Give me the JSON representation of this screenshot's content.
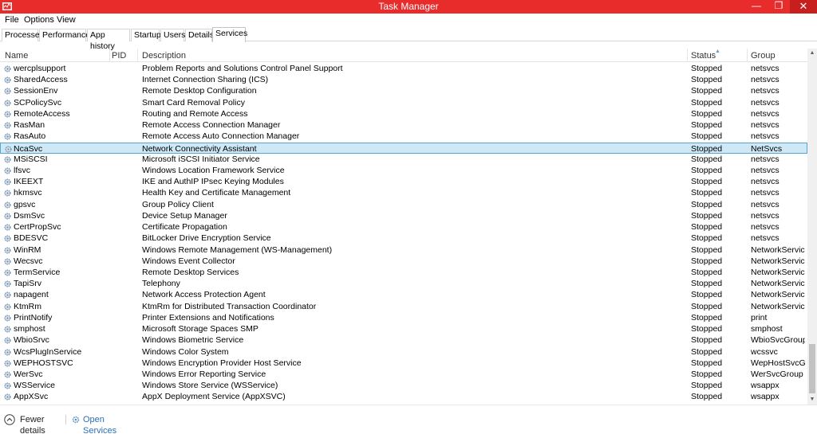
{
  "window": {
    "title": "Task Manager",
    "minimize_glyph": "—",
    "maximize_glyph": "❐",
    "close_glyph": "✕"
  },
  "menu": [
    "File",
    "Options",
    "View"
  ],
  "tabs": [
    {
      "label": "Processes",
      "active": false
    },
    {
      "label": "Performance",
      "active": false
    },
    {
      "label": "App history",
      "active": false
    },
    {
      "label": "Startup",
      "active": false
    },
    {
      "label": "Users",
      "active": false
    },
    {
      "label": "Details",
      "active": false
    },
    {
      "label": "Services",
      "active": true
    }
  ],
  "columns": {
    "name": "Name",
    "pid": "PID",
    "description": "Description",
    "status": "Status",
    "group": "Group",
    "sorted_by": "status"
  },
  "services": [
    {
      "name": "wercplsupport",
      "pid": "",
      "description": "Problem Reports and Solutions Control Panel Support",
      "status": "Stopped",
      "group": "netsvcs"
    },
    {
      "name": "SharedAccess",
      "pid": "",
      "description": "Internet Connection Sharing (ICS)",
      "status": "Stopped",
      "group": "netsvcs"
    },
    {
      "name": "SessionEnv",
      "pid": "",
      "description": "Remote Desktop Configuration",
      "status": "Stopped",
      "group": "netsvcs"
    },
    {
      "name": "SCPolicySvc",
      "pid": "",
      "description": "Smart Card Removal Policy",
      "status": "Stopped",
      "group": "netsvcs"
    },
    {
      "name": "RemoteAccess",
      "pid": "",
      "description": "Routing and Remote Access",
      "status": "Stopped",
      "group": "netsvcs"
    },
    {
      "name": "RasMan",
      "pid": "",
      "description": "Remote Access Connection Manager",
      "status": "Stopped",
      "group": "netsvcs"
    },
    {
      "name": "RasAuto",
      "pid": "",
      "description": "Remote Access Auto Connection Manager",
      "status": "Stopped",
      "group": "netsvcs"
    },
    {
      "name": "NcaSvc",
      "pid": "",
      "description": "Network Connectivity Assistant",
      "status": "Stopped",
      "group": "NetSvcs",
      "selected": true
    },
    {
      "name": "MSiSCSI",
      "pid": "",
      "description": "Microsoft iSCSI Initiator Service",
      "status": "Stopped",
      "group": "netsvcs"
    },
    {
      "name": "lfsvc",
      "pid": "",
      "description": "Windows Location Framework Service",
      "status": "Stopped",
      "group": "netsvcs"
    },
    {
      "name": "IKEEXT",
      "pid": "",
      "description": "IKE and AuthIP IPsec Keying Modules",
      "status": "Stopped",
      "group": "netsvcs"
    },
    {
      "name": "hkmsvc",
      "pid": "",
      "description": "Health Key and Certificate Management",
      "status": "Stopped",
      "group": "netsvcs"
    },
    {
      "name": "gpsvc",
      "pid": "",
      "description": "Group Policy Client",
      "status": "Stopped",
      "group": "netsvcs"
    },
    {
      "name": "DsmSvc",
      "pid": "",
      "description": "Device Setup Manager",
      "status": "Stopped",
      "group": "netsvcs"
    },
    {
      "name": "CertPropSvc",
      "pid": "",
      "description": "Certificate Propagation",
      "status": "Stopped",
      "group": "netsvcs"
    },
    {
      "name": "BDESVC",
      "pid": "",
      "description": "BitLocker Drive Encryption Service",
      "status": "Stopped",
      "group": "netsvcs"
    },
    {
      "name": "WinRM",
      "pid": "",
      "description": "Windows Remote Management (WS-Management)",
      "status": "Stopped",
      "group": "NetworkService"
    },
    {
      "name": "Wecsvc",
      "pid": "",
      "description": "Windows Event Collector",
      "status": "Stopped",
      "group": "NetworkService"
    },
    {
      "name": "TermService",
      "pid": "",
      "description": "Remote Desktop Services",
      "status": "Stopped",
      "group": "NetworkService"
    },
    {
      "name": "TapiSrv",
      "pid": "",
      "description": "Telephony",
      "status": "Stopped",
      "group": "NetworkService"
    },
    {
      "name": "napagent",
      "pid": "",
      "description": "Network Access Protection Agent",
      "status": "Stopped",
      "group": "NetworkService"
    },
    {
      "name": "KtmRm",
      "pid": "",
      "description": "KtmRm for Distributed Transaction Coordinator",
      "status": "Stopped",
      "group": "NetworkServic..."
    },
    {
      "name": "PrintNotify",
      "pid": "",
      "description": "Printer Extensions and Notifications",
      "status": "Stopped",
      "group": "print"
    },
    {
      "name": "smphost",
      "pid": "",
      "description": "Microsoft Storage Spaces SMP",
      "status": "Stopped",
      "group": "smphost"
    },
    {
      "name": "WbioSrvc",
      "pid": "",
      "description": "Windows Biometric Service",
      "status": "Stopped",
      "group": "WbioSvcGroup"
    },
    {
      "name": "WcsPlugInService",
      "pid": "",
      "description": "Windows Color System",
      "status": "Stopped",
      "group": "wcssvc"
    },
    {
      "name": "WEPHOSTSVC",
      "pid": "",
      "description": "Windows Encryption Provider Host Service",
      "status": "Stopped",
      "group": "WepHostSvcG..."
    },
    {
      "name": "WerSvc",
      "pid": "",
      "description": "Windows Error Reporting Service",
      "status": "Stopped",
      "group": "WerSvcGroup"
    },
    {
      "name": "WSService",
      "pid": "",
      "description": "Windows Store Service (WSService)",
      "status": "Stopped",
      "group": "wsappx"
    },
    {
      "name": "AppXSvc",
      "pid": "",
      "description": "AppX Deployment Service (AppXSVC)",
      "status": "Stopped",
      "group": "wsappx"
    }
  ],
  "footer": {
    "fewer_details": "Fewer details",
    "open_services": "Open Services"
  },
  "colors": {
    "titlebar": "#e82b2b",
    "selection_fill": "#cde8f7",
    "selection_border": "#58a6d0",
    "link": "#2a6fb8"
  },
  "icons": {
    "service": "gear-icon",
    "app": "task-manager-icon",
    "fewer_details": "chevron-up-circle-icon",
    "open_services": "services-gear-icon"
  }
}
